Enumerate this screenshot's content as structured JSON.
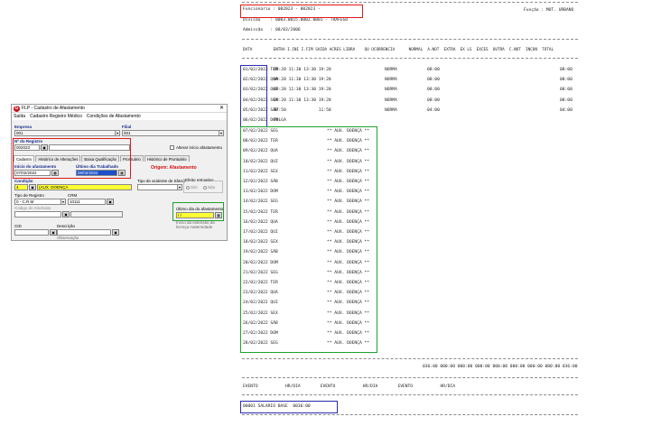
{
  "dialog": {
    "title": "FLP - Cadastro de Afastamento",
    "logo_letter": "G",
    "close_glyph": "✕",
    "menu": [
      "Saída",
      "Cadastro Registro Médico",
      "Condições de Afastamento"
    ],
    "empresa_label": "Empresa",
    "empresa_value": "001",
    "filial_label": "Filial",
    "filial_value": "001",
    "registro_label": "Nº do Registro",
    "registro_value": "002023",
    "alterar_label": "Alterar início afastamento",
    "tabs": [
      "Cadastro",
      "Histórico de Alterações",
      "Baixa Qualificação",
      "Prontuário",
      "Histórico de Prontuário"
    ],
    "inicio_label": "Início do afastamento",
    "inicio_value": "07/02/2022",
    "ultimo_trab_label": "Último dia Trabalhado",
    "ultimo_trab_value": "06/02/2022",
    "origem_label": "Origem: Afastamento",
    "condicao_label": "Condição",
    "condicao_code": "4",
    "condicao_value": "(AUX. DOENÇA",
    "acidente_label": "Tipo de acidente de trânsito",
    "efeito_label": "Efeito retroativo",
    "sim_label": "Sim",
    "nao_label": "Não",
    "tipo_registro_label": "Tipo de Registro",
    "tipo_registro_value": "0 - C.R.M",
    "crm_label": "CRM",
    "crm_value": "10111",
    "codigo_label": "Código do Sindicato",
    "ultimo_afast_label": "Último dia do afastamento",
    "ultimo_afast_value": "/ /",
    "licenca_label": "Início da extensão da licença maternidade",
    "cid_label": "CID",
    "descricao_label": "Descrição",
    "observacao_label": "Observação"
  },
  "report": {
    "funcionario": "Funcionario : 002023 - 002023 -",
    "funcao": "Função : MOT. URBANO",
    "divisao": "Divisao    : 0003.0015.0002.0001 - TRAFEGO",
    "admissao": "Admissão   : 08/03/2006",
    "columns": "DATA         ENTRA I.INI I.FIM SAIDA ACRES LIBRA    QU OCORRENCIA      NORMAL  A.NOT  EXTRA  EX LS  EXCES  OUTRA  C.NOT  INCON  TOTAL",
    "worked_rows": [
      {
        "date": "01/02/2022 TER",
        "times": "09:20 11:30 13:30 19:20",
        "occ": "NORMA",
        "normal": "08:00",
        "total": "08:00"
      },
      {
        "date": "02/02/2022 QUA",
        "times": "09:20 11:30 13:30 19:20",
        "occ": "NORMA",
        "normal": "08:00",
        "total": "08:00"
      },
      {
        "date": "03/02/2022 QUI",
        "times": "09:20 11:30 13:30 19:20",
        "occ": "NORMA",
        "normal": "08:00",
        "total": "08:00"
      },
      {
        "date": "04/02/2022 SEX",
        "times": "09:20 11:30 13:30 19:20",
        "occ": "NORMA",
        "normal": "08:00",
        "total": "08:00"
      },
      {
        "date": "05/02/2022 SÁB",
        "times": "07:50             11:50",
        "occ": "NORMA",
        "normal": "04:00",
        "total": "04:00"
      },
      {
        "date": "06/02/2022 DOM",
        "times": "FOLGA",
        "occ": "",
        "normal": "",
        "total": ""
      }
    ],
    "aux_text": "** AUX. DOENÇA **",
    "aux_rows": [
      "07/02/2022 SEG",
      "08/02/2022 TER",
      "09/02/2022 QUA",
      "10/02/2022 QUI",
      "11/02/2022 SEX",
      "12/02/2022 SÁB",
      "13/02/2022 DOM",
      "14/02/2022 SEG",
      "15/02/2022 TER",
      "16/02/2022 QUA",
      "17/02/2022 QUI",
      "18/02/2022 SEX",
      "19/02/2022 SÁB",
      "20/02/2022 DOM",
      "21/02/2022 SEG",
      "22/02/2022 TER",
      "23/02/2022 QUA",
      "24/02/2022 QUI",
      "25/02/2022 SEX",
      "26/02/2022 SÁB",
      "27/02/2022 DOM",
      "28/02/2022 SEG"
    ],
    "totals": "036:00 000:00 000:00 000:00 000:00 000:00 000:00 000:00 036:00",
    "evento_header": "EVENTO           HR/DIA        EVENTO           HR/DIA        EVENTO           HR/DIA",
    "evento_row": "00001 SALARIO BASE  0036:00"
  }
}
